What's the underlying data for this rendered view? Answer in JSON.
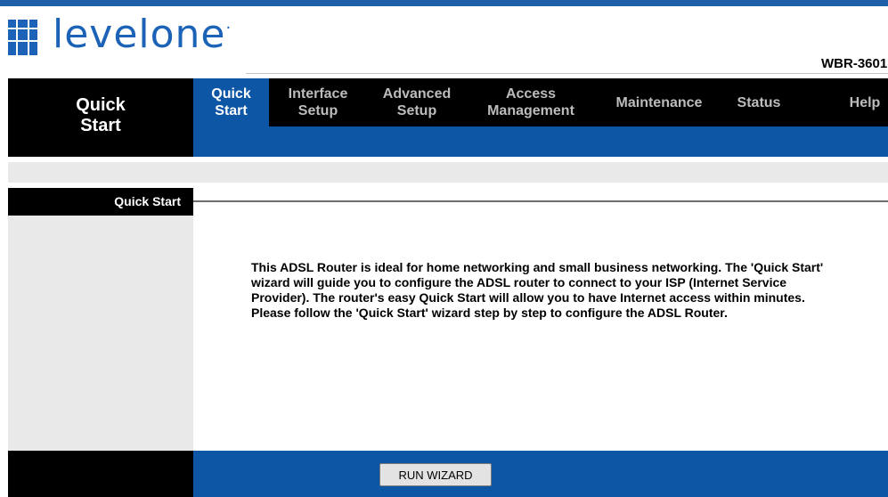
{
  "brand": {
    "logo_text": "levelone",
    "logo_dot": "·",
    "model": "WBR-3601"
  },
  "nav": {
    "section_title": "Quick Start",
    "tabs": [
      {
        "label": "Quick Start",
        "active": true
      },
      {
        "label": "Interface Setup",
        "active": false
      },
      {
        "label": "Advanced Setup",
        "active": false
      },
      {
        "label": "Access Management",
        "active": false
      },
      {
        "label": "Maintenance",
        "active": false
      },
      {
        "label": "Status",
        "active": false
      },
      {
        "label": "Help",
        "active": false
      }
    ]
  },
  "content": {
    "section_label": "Quick Start",
    "description": "This ADSL Router is ideal for home networking and small business networking. The 'Quick Start' wizard will guide you to configure the ADSL router to connect to your ISP (Internet Service Provider). The router's easy Quick Start will allow you to have Internet access within minutes. Please follow the 'Quick Start' wizard step by step to configure the ADSL Router."
  },
  "footer": {
    "run_wizard_label": "RUN WIZARD"
  },
  "colors": {
    "brand_blue": "#1c63b7",
    "nav_blue": "#0d56a6",
    "nav_black": "#000000",
    "panel_gray": "#e9e9e9"
  },
  "icons": {
    "logo": "levelone-logo-icon"
  }
}
